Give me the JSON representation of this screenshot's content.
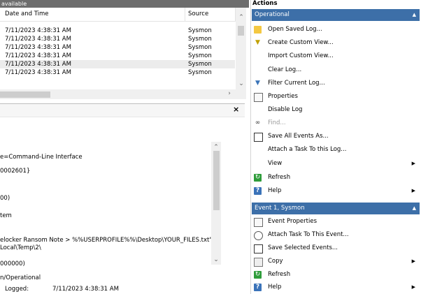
{
  "top_bar": {
    "text": "available"
  },
  "grid": {
    "columns": {
      "date": "Date and Time",
      "source": "Source"
    },
    "rows": [
      {
        "date": "7/11/2023 4:38:31 AM",
        "source": "Sysmon"
      },
      {
        "date": "7/11/2023 4:38:31 AM",
        "source": "Sysmon"
      },
      {
        "date": "7/11/2023 4:38:31 AM",
        "source": "Sysmon"
      },
      {
        "date": "7/11/2023 4:38:31 AM",
        "source": "Sysmon"
      },
      {
        "date": "7/11/2023 4:38:31 AM",
        "source": "Sysmon"
      },
      {
        "date": "7/11/2023 4:38:31 AM",
        "source": "Sysmon"
      }
    ]
  },
  "detail": {
    "close": "×",
    "lines": [
      "e=Command-Line Interface",
      "0002601}",
      "00)",
      "tem",
      "elocker Ransom Note > %%USERPROFILE%%\\Desktop\\YOUR_FILES.txt\"",
      "Local\\Temp\\2\\",
      "000000)",
      "n/Operational"
    ],
    "logged_label": "Logged:",
    "logged_value": "7/11/2023 4:38:31 AM"
  },
  "actions": {
    "title": "Actions",
    "section1": {
      "title": "Operational",
      "items": [
        {
          "label": "Open Saved Log...",
          "icon": "folder-open-icon"
        },
        {
          "label": "Create Custom View...",
          "icon": "filter-icon"
        },
        {
          "label": "Import Custom View...",
          "icon": ""
        },
        {
          "label": "Clear Log...",
          "icon": ""
        },
        {
          "label": "Filter Current Log...",
          "icon": "filter-icon"
        },
        {
          "label": "Properties",
          "icon": "properties-icon"
        },
        {
          "label": "Disable Log",
          "icon": ""
        },
        {
          "label": "Find...",
          "icon": "binoculars-icon"
        },
        {
          "label": "Save All Events As...",
          "icon": "save-icon"
        },
        {
          "label": "Attach a Task To this Log...",
          "icon": ""
        },
        {
          "label": "View",
          "icon": ""
        },
        {
          "label": "Refresh",
          "icon": "refresh-icon"
        },
        {
          "label": "Help",
          "icon": "help-icon"
        }
      ]
    },
    "section2": {
      "title": "Event 1, Sysmon",
      "items": [
        {
          "label": "Event Properties",
          "icon": "properties-icon"
        },
        {
          "label": "Attach Task To This Event...",
          "icon": "task-icon"
        },
        {
          "label": "Save Selected Events...",
          "icon": "save-icon"
        },
        {
          "label": "Copy",
          "icon": "copy-icon"
        },
        {
          "label": "Refresh",
          "icon": "refresh-icon"
        },
        {
          "label": "Help",
          "icon": "help-icon"
        }
      ]
    }
  },
  "colors": {
    "section_header": "#3d6fa8",
    "top_bar": "#6d6d6d",
    "row_selected": "#ececec"
  }
}
